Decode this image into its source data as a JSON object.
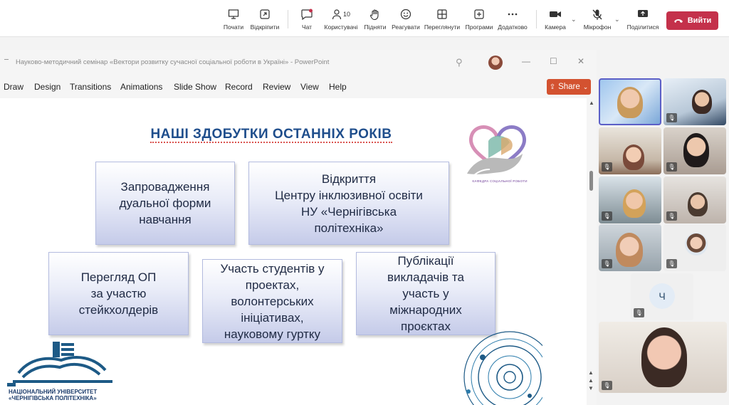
{
  "toolbar": {
    "start_label": "Почати",
    "detach_label": "Відкріпити",
    "chat_label": "Чат",
    "people_label": "Користувачі",
    "people_count": "10",
    "raise_label": "Підняти",
    "react_label": "Реагувати",
    "view_label": "Переглянути",
    "apps_label": "Програми",
    "more_label": "Додатково",
    "camera_label": "Камера",
    "mic_label": "Мікрофон",
    "share_label": "Поділитися",
    "leave_label": "Вийти"
  },
  "ppt": {
    "window_title": "Науково-методичний семінар «Вектори розвитку сучасної соціальної роботи в Україні»  -  PowerPoint",
    "menu": [
      "Draw",
      "Design",
      "Transitions",
      "Animations",
      "Slide Show",
      "Record",
      "Review",
      "View",
      "Help"
    ],
    "share_label": "Share"
  },
  "slide": {
    "title": "НАШІ ЗДОБУТКИ ОСТАННІХ РОКІВ",
    "boxes": [
      "Запровадження\nдуальної форми\nнавчання",
      "Відкриття\nЦентру інклюзивної освіти\nНУ «Чернігівська\nполітехніка»",
      "Перегляд ОП\nза участю\nстейкхолдерів",
      "Участь студентів у\nпроектах,\nволонтерських\nініціативах,\nнауковому гуртку",
      "Публікації\nвикладачів та\nучасть у\nміжнародних\nпроєктах"
    ],
    "logo_caption": "КАФЕДРА СОЦІАЛЬНОЇ РОБОТИ",
    "university_line1": "НАЦІОНАЛЬНИЙ УНІВЕРСИТЕТ",
    "university_line2": "«ЧЕРНІГІВСЬКА ПОЛІТЕХНІКА»"
  },
  "participants": {
    "initial_avatar": "Ч"
  },
  "colors": {
    "leave": "#c4314b",
    "share": "#d35230",
    "title": "#1f4e8c"
  }
}
